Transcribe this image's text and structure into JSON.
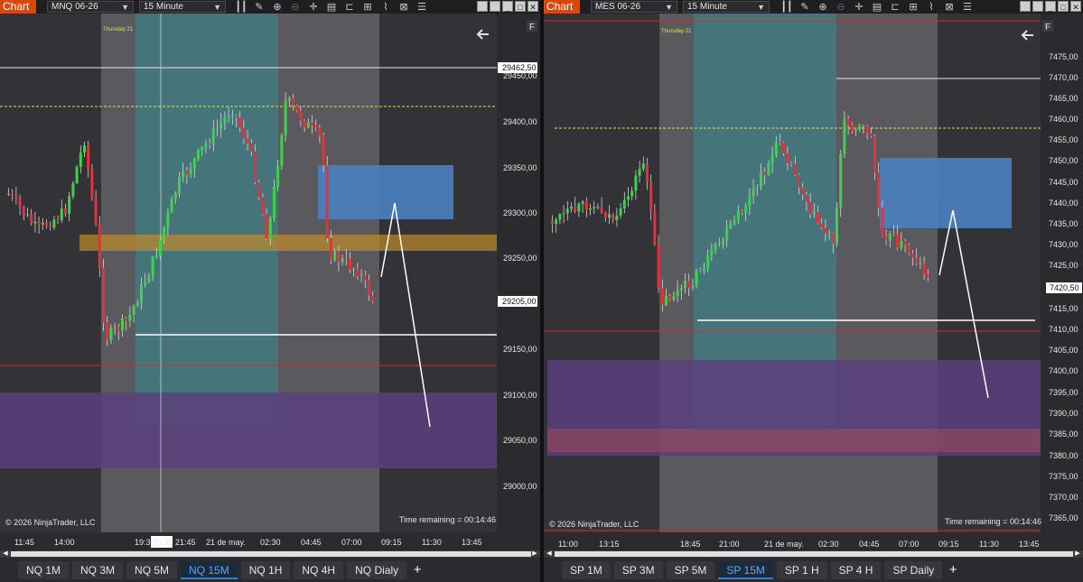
{
  "panels": [
    {
      "id": "left",
      "chart_label": "Chart",
      "instrument": "MNQ 06-26",
      "timeframe": "15 Minute",
      "day_label": "Thursday 21",
      "flag": "F",
      "copyright": "© 2026 NinjaTrader, LLC",
      "time_remaining": "Time remaining = 00:14:46",
      "price_labels": [
        "29450,00",
        "29400,00",
        "29350,00",
        "29300,00",
        "29250,00",
        "29150,00",
        "29100,00",
        "29050,00",
        "29000,00"
      ],
      "price_high_tag": "29462,50",
      "price_last_tag": "29205,00",
      "time_labels": [
        "11:45",
        "14:00",
        "19:3",
        "20:30",
        "21:45",
        "21 de may.",
        "02:30",
        "04:45",
        "07:00",
        "09:15",
        "11:30",
        "13:45"
      ],
      "tabs": [
        "NQ 1M",
        "NQ 3M",
        "NQ 5M",
        "NQ 15M",
        "NQ 1H",
        "NQ 4H",
        "NQ Dialy"
      ],
      "active_tab": "NQ 15M"
    },
    {
      "id": "right",
      "chart_label": "Chart",
      "instrument": "MES 06-26",
      "timeframe": "15 Minute",
      "day_label": "Thursday 21",
      "flag": "F",
      "copyright": "© 2026 NinjaTrader, LLC",
      "time_remaining": "Time remaining = 00:14:46",
      "price_labels": [
        "7475,00",
        "7470,00",
        "7465,00",
        "7460,00",
        "7455,00",
        "7450,00",
        "7445,00",
        "7440,00",
        "7435,00",
        "7430,00",
        "7425,00",
        "7415,00",
        "7410,00",
        "7405,00",
        "7400,00",
        "7395,00",
        "7390,00",
        "7385,00",
        "7380,00",
        "7375,00",
        "7370,00",
        "7365,00"
      ],
      "price_last_tag": "7420,50",
      "time_labels": [
        "11:00",
        "13:15",
        "18:45",
        "21:00",
        "21 de may.",
        "02:30",
        "04:45",
        "07:00",
        "09:15",
        "11:30",
        "13:45"
      ],
      "tabs": [
        "SP 1M",
        "SP 3M",
        "SP 5M",
        "SP 15M",
        "SP 1 H",
        "SP 4 H",
        "SP Daily"
      ],
      "active_tab": "SP 15M"
    }
  ],
  "tab_add_label": "+",
  "colors": {
    "up_candle": "#3fd14a",
    "down_candle": "#e8303a",
    "zone_blue": "#4a7fc0",
    "zone_orange": "#c08a2a",
    "zone_purple": "#5a3f7a",
    "zone_teal": "#3f7f85",
    "level_yellow": "#e7e23a",
    "level_red": "#d22a2a",
    "brand": "#d9470b"
  }
}
